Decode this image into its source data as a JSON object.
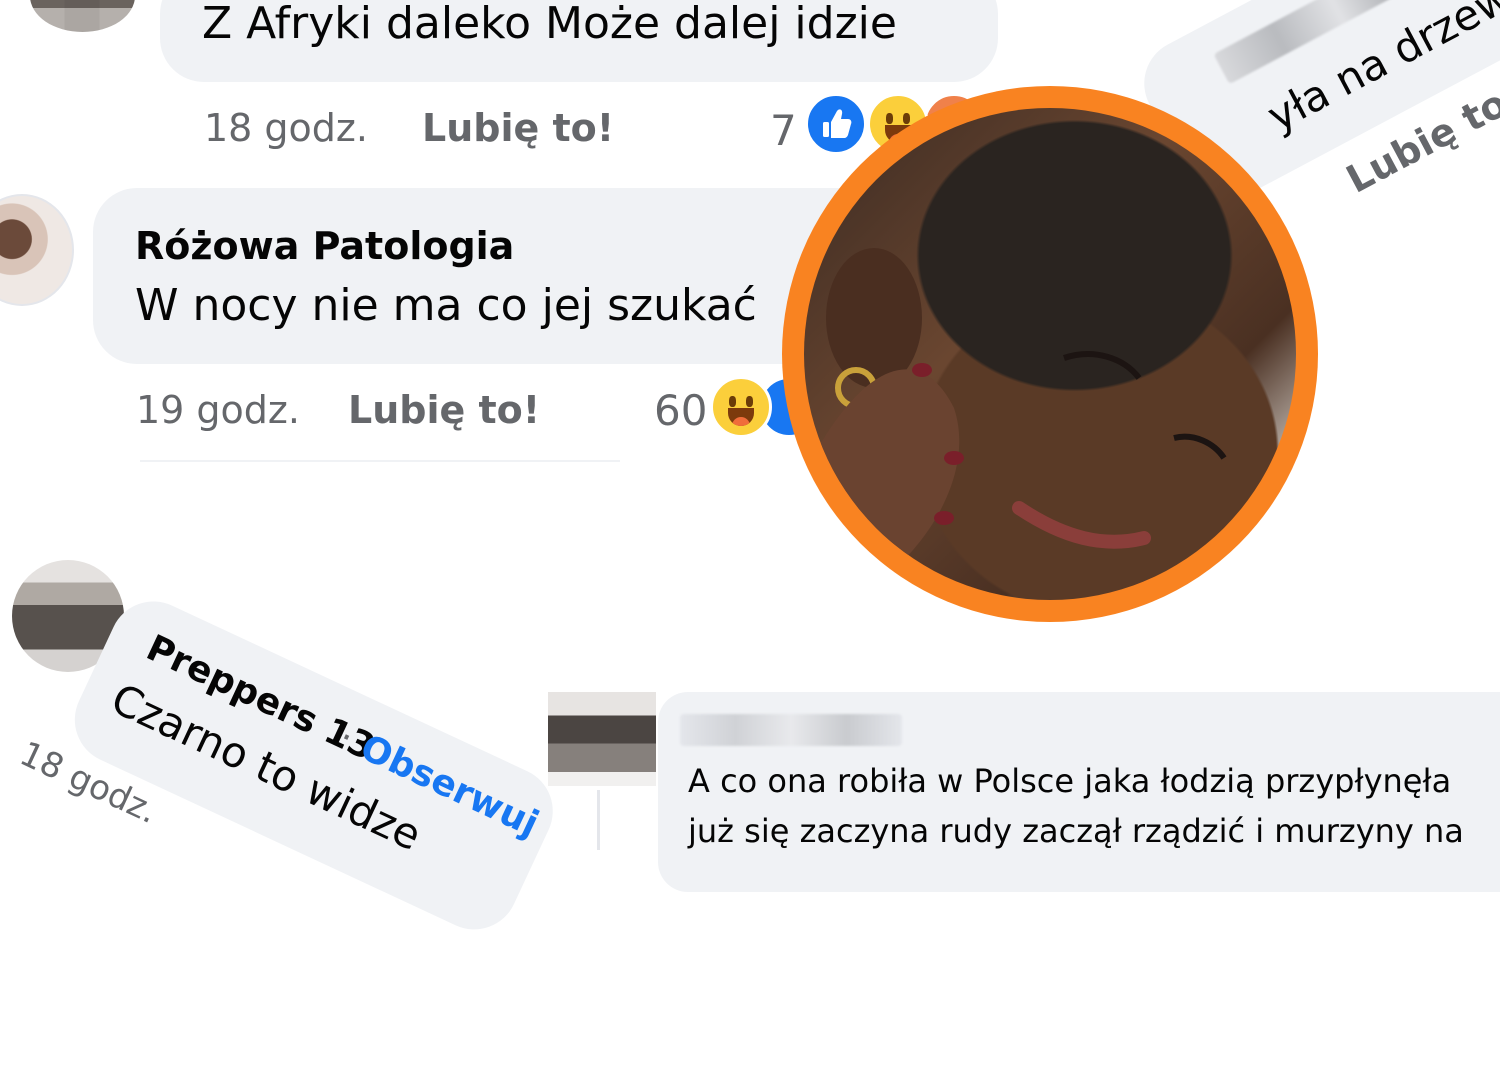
{
  "comments": [
    {
      "text": "Z Afryki daleko Może dalej idzie",
      "time": "18 godz.",
      "like_label": "Lubię to!",
      "reaction_count": "7",
      "reactions": [
        "like-icon",
        "laugh-emoji",
        "care-emoji"
      ]
    },
    {
      "author": "Różowa Patologia",
      "text": "W nocy nie ma co jej szukać",
      "time": "19 godz.",
      "like_label": "Lubię to!",
      "reaction_count": "60",
      "reactions": [
        "laugh-emoji",
        "like-icon"
      ]
    },
    {
      "author": "Preppers 13",
      "separator": "·",
      "follow_label": "Obserwuj",
      "text": "Czarno to widze",
      "time": "18 godz."
    },
    {
      "text_line1": "A co ona robiła w Polsce jaka łodzią przypłynęła",
      "text_line2": "już się zaczyna rudy zaczął rządzić i murzyny na"
    },
    {
      "text": "yła na drzew",
      "like_label": "Lubię to!"
    }
  ],
  "colors": {
    "bubble": "#f0f2f5",
    "meta": "#65676b",
    "follow_link": "#1877f2",
    "frame_orange": "#f98321",
    "like_blue": "#1877f2"
  }
}
